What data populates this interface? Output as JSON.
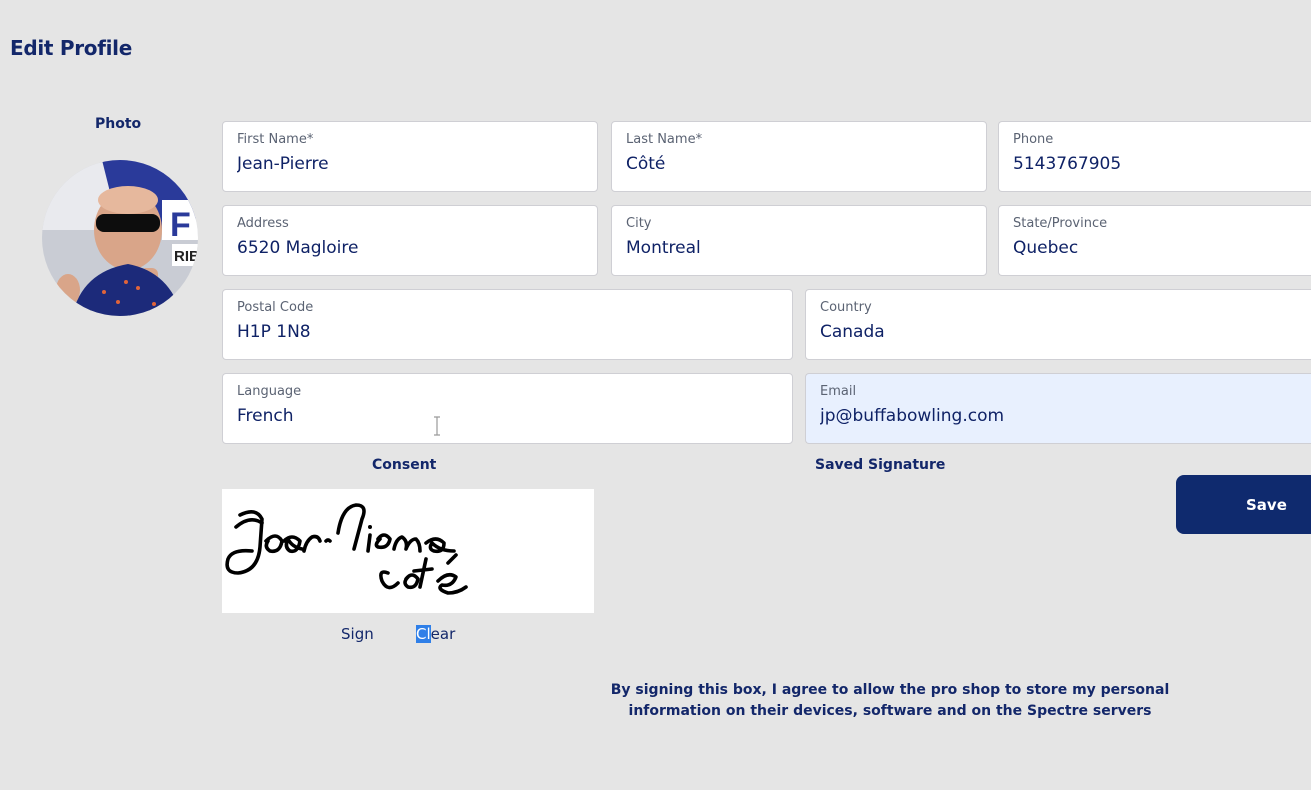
{
  "header": {
    "title": "Edit Profile",
    "photo_label": "Photo"
  },
  "form": {
    "first_name": {
      "label": "First Name*",
      "value": "Jean-Pierre"
    },
    "last_name": {
      "label": "Last Name*",
      "value": "Côté"
    },
    "phone": {
      "label": "Phone",
      "value": "5143767905"
    },
    "address": {
      "label": "Address",
      "value": "6520 Magloire"
    },
    "city": {
      "label": "City",
      "value": "Montreal"
    },
    "state": {
      "label": "State/Province",
      "value": "Quebec"
    },
    "postal_code": {
      "label": "Postal Code",
      "value": "H1P 1N8"
    },
    "country": {
      "label": "Country",
      "value": "Canada"
    },
    "language": {
      "label": "Language",
      "value": "French"
    },
    "email": {
      "label": "Email",
      "value": "jp@buffabowling.com"
    }
  },
  "consent": {
    "label": "Consent",
    "saved_signature_label": "Saved Signature",
    "sign_label": "Sign",
    "clear_label_selected": "Cl",
    "clear_label_rest": "ear",
    "text": "By signing this box, I agree to allow the pro shop to store my personal information on their devices, software and on the Spectre servers"
  },
  "actions": {
    "save_label": "Save"
  },
  "colors": {
    "background": "#e5e5e5",
    "accent": "#0f2a6e",
    "heading": "#13276a",
    "autofill": "#e8f0fe",
    "selection": "#2f7fe8"
  },
  "icons": [
    "text-cursor-icon"
  ]
}
